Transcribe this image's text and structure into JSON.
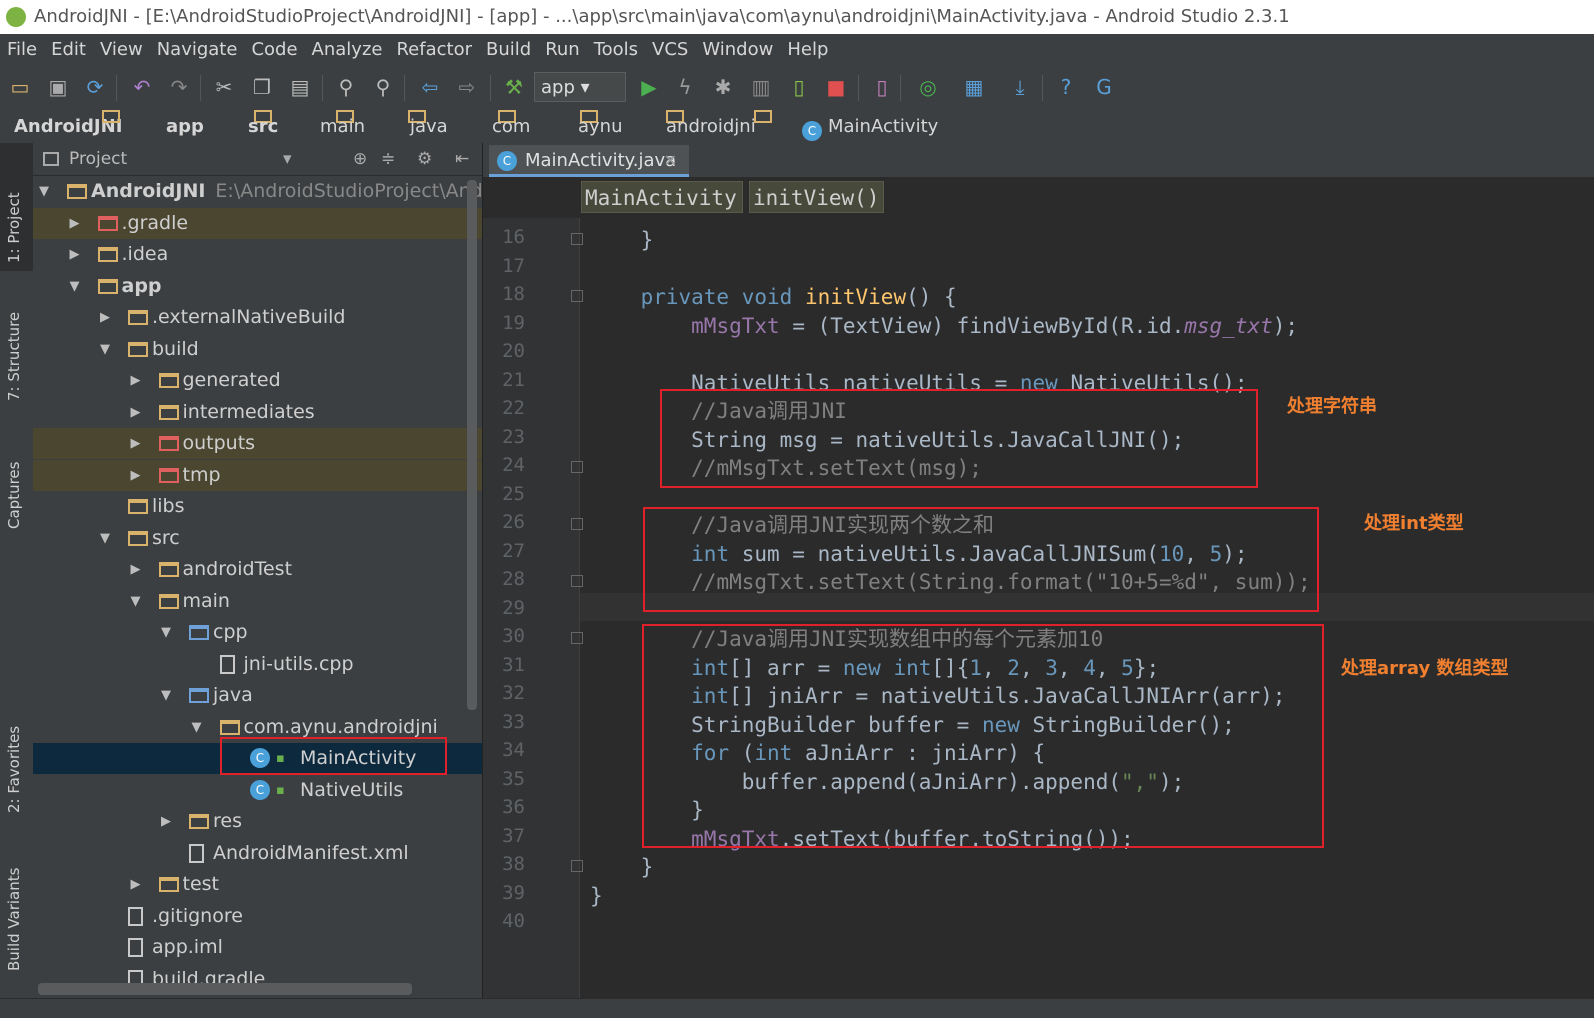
{
  "window": {
    "title": "AndroidJNI - [E:\\AndroidStudioProject\\AndroidJNI] - [app] - ...\\app\\src\\main\\java\\com\\aynu\\androidjni\\MainActivity.java - Android Studio 2.3.1"
  },
  "menu": [
    "File",
    "Edit",
    "View",
    "Navigate",
    "Code",
    "Analyze",
    "Refactor",
    "Build",
    "Run",
    "Tools",
    "VCS",
    "Window",
    "Help"
  ],
  "toolbar": {
    "run_config": "app",
    "icons": [
      "open-folder-icon",
      "save-icon",
      "sync-icon",
      "undo-icon",
      "redo-icon",
      "cut-icon",
      "copy-icon",
      "paste-icon",
      "find-icon",
      "replace-icon",
      "back-icon",
      "forward-icon",
      "make-project-icon",
      "run-icon",
      "instant-run-icon",
      "debug-icon",
      "profile-icon",
      "attach-debugger-icon",
      "stop-icon",
      "avd-manager-icon",
      "sync-gradle-icon",
      "project-structure-icon",
      "sdk-manager-icon",
      "help-icon",
      "translate-icon"
    ]
  },
  "breadcrumb": [
    "AndroidJNI",
    "app",
    "src",
    "main",
    "java",
    "com",
    "aynu",
    "androidjni",
    "MainActivity"
  ],
  "side_tabs": [
    "1: Project",
    "7: Structure",
    "Captures",
    "2: Favorites",
    "Build Variants"
  ],
  "project_panel": {
    "title": "Project",
    "tree": [
      {
        "label": "AndroidJNI",
        "hint": "E:\\AndroidStudioProject\\AndroidJNI",
        "depth": 0,
        "arrow": "down",
        "icon": "folder"
      },
      {
        "label": ".gradle",
        "depth": 1,
        "arrow": "right",
        "icon": "red",
        "dim": true
      },
      {
        "label": ".idea",
        "depth": 1,
        "arrow": "right",
        "icon": "folder"
      },
      {
        "label": "app",
        "depth": 1,
        "arrow": "down",
        "icon": "folder",
        "bold": true
      },
      {
        "label": ".externalNativeBuild",
        "depth": 2,
        "arrow": "right",
        "icon": "folder"
      },
      {
        "label": "build",
        "depth": 2,
        "arrow": "down",
        "icon": "folder"
      },
      {
        "label": "generated",
        "depth": 3,
        "arrow": "right",
        "icon": "folder"
      },
      {
        "label": "intermediates",
        "depth": 3,
        "arrow": "right",
        "icon": "folder"
      },
      {
        "label": "outputs",
        "depth": 3,
        "arrow": "right",
        "icon": "red",
        "dim": true
      },
      {
        "label": "tmp",
        "depth": 3,
        "arrow": "right",
        "icon": "red",
        "dim": true
      },
      {
        "label": "libs",
        "depth": 2,
        "arrow": "",
        "icon": "folder"
      },
      {
        "label": "src",
        "depth": 2,
        "arrow": "down",
        "icon": "folder"
      },
      {
        "label": "androidTest",
        "depth": 3,
        "arrow": "right",
        "icon": "folder"
      },
      {
        "label": "main",
        "depth": 3,
        "arrow": "down",
        "icon": "folder"
      },
      {
        "label": "cpp",
        "depth": 4,
        "arrow": "down",
        "icon": "blue"
      },
      {
        "label": "jni-utils.cpp",
        "depth": 5,
        "arrow": "",
        "icon": "file"
      },
      {
        "label": "java",
        "depth": 4,
        "arrow": "down",
        "icon": "blue"
      },
      {
        "label": "com.aynu.androidjni",
        "depth": 5,
        "arrow": "down",
        "icon": "folder"
      },
      {
        "label": "MainActivity",
        "depth": 6,
        "arrow": "",
        "icon": "cls",
        "selected": true
      },
      {
        "label": "NativeUtils",
        "depth": 6,
        "arrow": "",
        "icon": "cls"
      },
      {
        "label": "res",
        "depth": 4,
        "arrow": "right",
        "icon": "folder"
      },
      {
        "label": "AndroidManifest.xml",
        "depth": 4,
        "arrow": "",
        "icon": "file"
      },
      {
        "label": "test",
        "depth": 3,
        "arrow": "right",
        "icon": "folder"
      },
      {
        "label": ".gitignore",
        "depth": 2,
        "arrow": "",
        "icon": "file"
      },
      {
        "label": "app.iml",
        "depth": 2,
        "arrow": "",
        "icon": "file"
      },
      {
        "label": "build.gradle",
        "depth": 2,
        "arrow": "",
        "icon": "file"
      }
    ]
  },
  "editor": {
    "tab": "MainActivity.java",
    "crumbs": [
      "MainActivity",
      "initView()"
    ],
    "line_numbers": [
      "16",
      "17",
      "18",
      "19",
      "20",
      "21",
      "22",
      "23",
      "24",
      "25",
      "26",
      "27",
      "28",
      "29",
      "30",
      "31",
      "32",
      "33",
      "34",
      "35",
      "36",
      "37",
      "38",
      "39",
      "40"
    ],
    "lines": [
      [
        [
          "    }",
          "t"
        ]
      ],
      [],
      [
        [
          "    ",
          "t"
        ],
        [
          "private void ",
          "kw"
        ],
        [
          "initView",
          "fn"
        ],
        [
          "() {",
          "t"
        ]
      ],
      [
        [
          "        ",
          "t"
        ],
        [
          "mMsgTxt",
          "mv"
        ],
        [
          " = (TextView) findViewById(R.id.",
          "t"
        ],
        [
          "msg_txt",
          "fld"
        ],
        [
          ");",
          "t"
        ]
      ],
      [],
      [
        [
          "        NativeUtils nativeUtils = ",
          "t"
        ],
        [
          "new ",
          "kw"
        ],
        [
          "NativeUtils();",
          "t"
        ]
      ],
      [
        [
          "        ",
          "t"
        ],
        [
          "//Java调用JNI",
          "cm"
        ]
      ],
      [
        [
          "        String msg = nativeUtils.JavaCallJNI();",
          "t"
        ]
      ],
      [
        [
          "        ",
          "t"
        ],
        [
          "//mMsgTxt.setText(msg);",
          "cm"
        ]
      ],
      [],
      [
        [
          "        ",
          "t"
        ],
        [
          "//Java调用JNI实现两个数之和",
          "cm"
        ]
      ],
      [
        [
          "        ",
          "t"
        ],
        [
          "int ",
          "kw"
        ],
        [
          "sum = nativeUtils.JavaCallJNISum(",
          "t"
        ],
        [
          "10",
          "num"
        ],
        [
          ", ",
          "t"
        ],
        [
          "5",
          "num"
        ],
        [
          ");",
          "t"
        ]
      ],
      [
        [
          "        ",
          "t"
        ],
        [
          "//mMsgTxt.setText(String.format(\"10+5=%d\", sum));",
          "cm"
        ]
      ],
      [],
      [
        [
          "        ",
          "t"
        ],
        [
          "//Java调用JNI实现数组中的每个元素加10",
          "cm"
        ]
      ],
      [
        [
          "        ",
          "t"
        ],
        [
          "int",
          "kw"
        ],
        [
          "[] arr = ",
          "t"
        ],
        [
          "new int",
          "kw"
        ],
        [
          "[]{",
          "t"
        ],
        [
          "1",
          "num"
        ],
        [
          ", ",
          "t"
        ],
        [
          "2",
          "num"
        ],
        [
          ", ",
          "t"
        ],
        [
          "3",
          "num"
        ],
        [
          ", ",
          "t"
        ],
        [
          "4",
          "num"
        ],
        [
          ", ",
          "t"
        ],
        [
          "5",
          "num"
        ],
        [
          "};",
          "t"
        ]
      ],
      [
        [
          "        ",
          "t"
        ],
        [
          "int",
          "kw"
        ],
        [
          "[] jniArr = nativeUtils.JavaCallJNIArr(arr);",
          "t"
        ]
      ],
      [
        [
          "        StringBuilder buffer = ",
          "t"
        ],
        [
          "new ",
          "kw"
        ],
        [
          "StringBuilder();",
          "t"
        ]
      ],
      [
        [
          "        ",
          "t"
        ],
        [
          "for ",
          "kw"
        ],
        [
          "(",
          "t"
        ],
        [
          "int ",
          "kw"
        ],
        [
          "aJniArr : jniArr) {",
          "t"
        ]
      ],
      [
        [
          "            buffer.append(aJniArr).append(",
          "t"
        ],
        [
          "\",\"",
          "str"
        ],
        [
          ");",
          "t"
        ]
      ],
      [
        [
          "        }",
          "t"
        ]
      ],
      [
        [
          "        ",
          "t"
        ],
        [
          "mMsgTxt",
          "mv"
        ],
        [
          ".setText(buffer.toString());",
          "t"
        ]
      ],
      [
        [
          "    }",
          "t"
        ]
      ],
      [
        [
          "}",
          "t"
        ]
      ],
      []
    ]
  },
  "annotations": {
    "string": "处理字符串",
    "int": "处理int类型",
    "array": "处理array 数组类型"
  },
  "colors": {
    "highlight_box": "#e0202a",
    "annotation_text": "#f08030",
    "editor_bg": "#2b2b2b"
  }
}
